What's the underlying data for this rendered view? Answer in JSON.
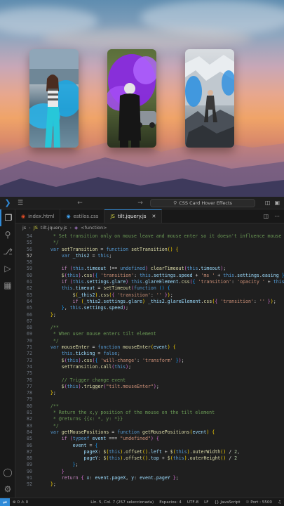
{
  "window": {
    "title": "CSS Card Hover Effects"
  },
  "colors": {
    "accent": "#2f8ad8",
    "editor_bg": "#1f1f1f"
  },
  "tabs": [
    {
      "label": "index.html",
      "icon": "html-file-icon",
      "color": "#e44d26",
      "active": false
    },
    {
      "label": "estilos.css",
      "icon": "css-file-icon",
      "color": "#42a5f5",
      "active": false
    },
    {
      "label": "tilt.jquery.js",
      "icon": "js-file-icon",
      "color": "#cbcb41",
      "active": true
    }
  ],
  "breadcrumb": {
    "folder": "js",
    "file": "tilt.jquery.js",
    "symbol": "<function>"
  },
  "code": {
    "current_line": "57",
    "lines": [
      {
        "n": "54",
        "html": "<span class=\"c\">     * Set transition only on mouse leave and mouse enter so it doesn't influence mouse move</span>"
      },
      {
        "n": "55",
        "html": "<span class=\"c\">     */</span>"
      },
      {
        "n": "56",
        "html": "    <span class=\"k\">var</span> <span class=\"f\">setTransition</span> = <span class=\"k\">function</span> <span class=\"f\">setTransition</span><span class=\"y\">()</span> <span class=\"y\">{</span>"
      },
      {
        "n": "57",
        "html": "        <span class=\"k\">var</span> <span class=\"v\">_this2</span> = <span class=\"k\">this</span>;"
      },
      {
        "n": "58",
        "html": ""
      },
      {
        "n": "59",
        "html": "        <span class=\"kc\">if</span> <span class=\"pk\">(</span><span class=\"k\">this</span>.<span class=\"v\">timeout</span> !== <span class=\"k\">undefined</span><span class=\"pk\">)</span> <span class=\"f\">clearTimeout</span><span class=\"pk\">(</span><span class=\"k\">this</span>.<span class=\"v\">timeout</span><span class=\"pk\">)</span>;"
      },
      {
        "n": "60",
        "html": "        <span class=\"f\">$</span><span class=\"pk\">(</span><span class=\"k\">this</span><span class=\"pk\">)</span>.<span class=\"f\">css</span><span class=\"pk\">(</span><span class=\"bl\">{</span> <span class=\"s\">'transition'</span>: <span class=\"k\">this</span>.<span class=\"v\">settings</span>.<span class=\"v\">speed</span> + <span class=\"s\">'ms '</span> + <span class=\"k\">this</span>.<span class=\"v\">settings</span>.<span class=\"v\">easing</span> <span class=\"bl\">}</span><span class=\"pk\">)</span>;"
      },
      {
        "n": "61",
        "html": "        <span class=\"kc\">if</span> <span class=\"pk\">(</span><span class=\"k\">this</span>.<span class=\"v\">settings</span>.<span class=\"v\">glare</span><span class=\"pk\">)</span> <span class=\"k\">this</span>.<span class=\"v\">glareElement</span>.<span class=\"f\">css</span><span class=\"pk\">(</span><span class=\"bl\">{</span> <span class=\"s\">'transition'</span>: <span class=\"s\">'opacity '</span> + <span class=\"k\">this</span>.<span class=\"v\">settings</span>"
      },
      {
        "n": "62",
        "html": "        <span class=\"k\">this</span>.<span class=\"v\">timeout</span> = <span class=\"f\">setTimeout</span><span class=\"pk\">(</span><span class=\"k\">function</span> <span class=\"bl\">()</span> <span class=\"bl\">{</span>"
      },
      {
        "n": "63",
        "html": "            <span class=\"f\">$</span><span class=\"y\">(</span><span class=\"v\">_this2</span><span class=\"y\">)</span>.<span class=\"f\">css</span><span class=\"y\">(</span><span class=\"pk\">{</span> <span class=\"s\">'transition'</span>: <span class=\"s\">''</span> <span class=\"pk\">}</span><span class=\"y\">)</span>;"
      },
      {
        "n": "64",
        "html": "            <span class=\"kc\">if</span> <span class=\"y\">(</span><span class=\"v\">_this2</span>.<span class=\"v\">settings</span>.<span class=\"v\">glare</span><span class=\"y\">)</span> <span class=\"v\">_this2</span>.<span class=\"v\">glareElement</span>.<span class=\"f\">css</span><span class=\"y\">(</span><span class=\"pk\">{</span> <span class=\"s\">'transition'</span>: <span class=\"s\">''</span> <span class=\"pk\">}</span><span class=\"y\">)</span>;"
      },
      {
        "n": "65",
        "html": "        <span class=\"bl\">}</span>, <span class=\"k\">this</span>.<span class=\"v\">settings</span>.<span class=\"v\">speed</span><span class=\"pk\">)</span>;"
      },
      {
        "n": "66",
        "html": "    <span class=\"y\">}</span>;"
      },
      {
        "n": "67",
        "html": ""
      },
      {
        "n": "68",
        "html": "    <span class=\"c\">/**</span>"
      },
      {
        "n": "69",
        "html": "<span class=\"c\">     * When user mouse enters tilt element</span>"
      },
      {
        "n": "70",
        "html": "<span class=\"c\">     */</span>"
      },
      {
        "n": "71",
        "html": "    <span class=\"k\">var</span> <span class=\"f\">mouseEnter</span> = <span class=\"k\">function</span> <span class=\"f\">mouseEnter</span><span class=\"y\">(</span><span class=\"v\">event</span><span class=\"y\">)</span> <span class=\"y\">{</span>"
      },
      {
        "n": "72",
        "html": "        <span class=\"k\">this</span>.<span class=\"v\">ticking</span> = <span class=\"k\">false</span>;"
      },
      {
        "n": "73",
        "html": "        <span class=\"f\">$</span><span class=\"pk\">(</span><span class=\"k\">this</span><span class=\"pk\">)</span>.<span class=\"f\">css</span><span class=\"pk\">(</span><span class=\"bl\">{</span> <span class=\"s\">'will-change'</span>: <span class=\"s\">'transform'</span> <span class=\"bl\">}</span><span class=\"pk\">)</span>;"
      },
      {
        "n": "74",
        "html": "        <span class=\"f\">setTransition</span>.<span class=\"f\">call</span><span class=\"pk\">(</span><span class=\"k\">this</span><span class=\"pk\">)</span>;"
      },
      {
        "n": "75",
        "html": ""
      },
      {
        "n": "76",
        "html": "        <span class=\"c\">// Trigger change event</span>"
      },
      {
        "n": "77",
        "html": "        <span class=\"f\">$</span><span class=\"pk\">(</span><span class=\"k\">this</span><span class=\"pk\">)</span>.<span class=\"f\">trigger</span><span class=\"pk\">(</span><span class=\"s\">\"tilt.mouseEnter\"</span><span class=\"pk\">)</span>;"
      },
      {
        "n": "78",
        "html": "    <span class=\"y\">}</span>;"
      },
      {
        "n": "79",
        "html": ""
      },
      {
        "n": "80",
        "html": "    <span class=\"c\">/**</span>"
      },
      {
        "n": "81",
        "html": "<span class=\"c\">     * Return the x,y position of the mouse on the tilt element</span>"
      },
      {
        "n": "82",
        "html": "<span class=\"c\">     * @returns {{x: *, y: *}}</span>"
      },
      {
        "n": "83",
        "html": "<span class=\"c\">     */</span>"
      },
      {
        "n": "84",
        "html": "    <span class=\"k\">var</span> <span class=\"f\">getMousePositions</span> = <span class=\"k\">function</span> <span class=\"f\">getMousePositions</span><span class=\"y\">(</span><span class=\"v\">event</span><span class=\"y\">)</span> <span class=\"y\">{</span>"
      },
      {
        "n": "85",
        "html": "        <span class=\"kc\">if</span> <span class=\"pk\">(</span><span class=\"k\">typeof</span> <span class=\"v\">event</span> === <span class=\"s\">\"undefined\"</span><span class=\"pk\">)</span> <span class=\"pk\">{</span>"
      },
      {
        "n": "86",
        "html": "            <span class=\"v\">event</span> = <span class=\"bl\">{</span>"
      },
      {
        "n": "87",
        "html": "                <span class=\"v\">pageX</span>: <span class=\"f\">$</span><span class=\"y\">(</span><span class=\"k\">this</span><span class=\"y\">)</span>.<span class=\"f\">offset</span><span class=\"y\">()</span>.<span class=\"v\">left</span> + <span class=\"f\">$</span><span class=\"y\">(</span><span class=\"k\">this</span><span class=\"y\">)</span>.<span class=\"f\">outerWidth</span><span class=\"y\">()</span> / <span class=\"n\">2</span>,"
      },
      {
        "n": "88",
        "html": "                <span class=\"v\">pageY</span>: <span class=\"f\">$</span><span class=\"y\">(</span><span class=\"k\">this</span><span class=\"y\">)</span>.<span class=\"f\">offset</span><span class=\"y\">()</span>.<span class=\"v\">top</span> + <span class=\"f\">$</span><span class=\"y\">(</span><span class=\"k\">this</span><span class=\"y\">)</span>.<span class=\"f\">outerHeight</span><span class=\"y\">()</span> / <span class=\"n\">2</span>"
      },
      {
        "n": "89",
        "html": "            <span class=\"bl\">}</span>;"
      },
      {
        "n": "90",
        "html": "        <span class=\"pk\">}</span>"
      },
      {
        "n": "91",
        "html": "        <span class=\"kc\">return</span> <span class=\"pk\">{</span> <span class=\"v\">x</span>: <span class=\"v\">event</span>.<span class=\"v\">pageX</span>, <span class=\"v\">y</span>: <span class=\"v\">event</span>.<span class=\"v\">pageY</span> <span class=\"pk\">}</span>;"
      },
      {
        "n": "92",
        "html": "    <span class=\"y\">}</span>;"
      }
    ]
  },
  "status": {
    "errors": "0",
    "warnings": "0",
    "position": "Lín. 5, Col. 7 (257 seleccionada)",
    "spaces": "Espacios: 4",
    "encoding": "UTF-8",
    "eol": "LF",
    "language": "{} JavaScript",
    "port": "Port : 5500"
  },
  "preview": {
    "cards": [
      {
        "name": "card-girl-blue-smoke"
      },
      {
        "name": "card-masked-purple-smoke"
      },
      {
        "name": "card-snow-blue-smoke"
      }
    ]
  }
}
